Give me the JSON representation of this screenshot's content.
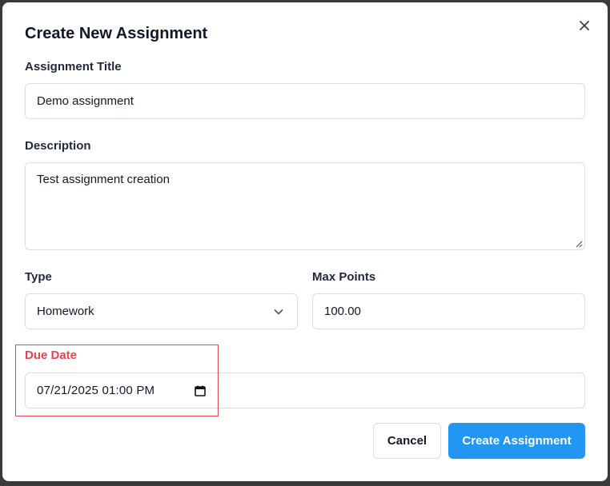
{
  "dialog": {
    "title": "Create New Assignment",
    "close_icon": "close-icon"
  },
  "form": {
    "title_label": "Assignment Title",
    "title_value": "Demo assignment",
    "description_label": "Description",
    "description_value": "Test assignment creation",
    "type_label": "Type",
    "type_value": "Homework",
    "max_points_label": "Max Points",
    "max_points_value": "100.00",
    "due_date_label": "Due Date",
    "due_date_value": "07/21/2025 01:00 PM",
    "due_date_error": true
  },
  "actions": {
    "cancel_label": "Cancel",
    "submit_label": "Create Assignment"
  },
  "colors": {
    "primary": "#2196f3",
    "error": "#e0474c",
    "border": "#d9dce1"
  }
}
